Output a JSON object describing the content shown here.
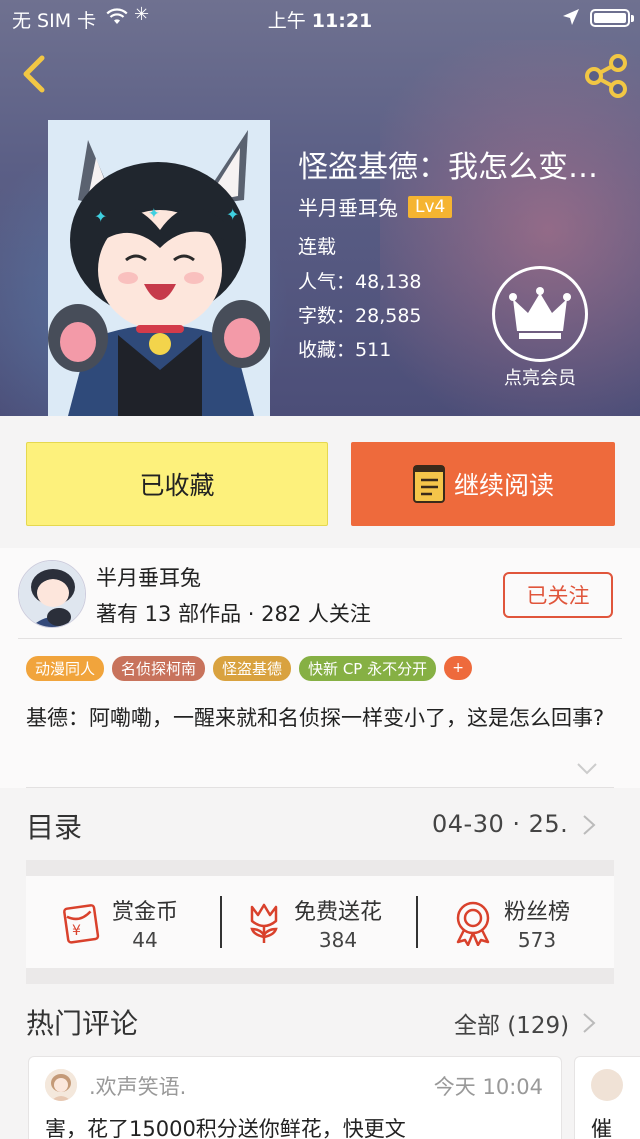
{
  "status_bar": {
    "carrier": "无 SIM 卡",
    "time_prefix": "上午",
    "time": "11:21"
  },
  "book": {
    "title": "怪盗基德：我怎么变…",
    "author": "半月垂耳兔",
    "author_level": "Lv4",
    "status": "连载",
    "popularity_label": "人气：",
    "popularity": "48,138",
    "words_label": "字数：",
    "words": "28,585",
    "favorites_label": "收藏：",
    "favorites": "511",
    "vip_label": "点亮会员"
  },
  "actions": {
    "favorited_label": "已收藏",
    "continue_label": "继续阅读"
  },
  "author_card": {
    "name": "半月垂耳兔",
    "stats": "著有 13 部作品 · 282 人关注",
    "follow_label": "已关注"
  },
  "tags": [
    {
      "label": "动漫同人",
      "color": "#f1a43c"
    },
    {
      "label": "名侦探柯南",
      "color": "#c8735c"
    },
    {
      "label": "怪盗基德",
      "color": "#d9a23f"
    },
    {
      "label": "快新 CP 永不分开",
      "color": "#86b044"
    }
  ],
  "tag_more": "+",
  "description": "基德：阿嘞嘞，一醒来就和名侦探一样变小了，这是怎么回事?",
  "toc": {
    "label": "目录",
    "latest": "04-30 · 25."
  },
  "rewards": [
    {
      "label": "赏金币",
      "value": "44",
      "icon": "red-envelope-icon"
    },
    {
      "label": "免费送花",
      "value": "384",
      "icon": "flower-icon"
    },
    {
      "label": "粉丝榜",
      "value": "573",
      "icon": "medal-icon"
    }
  ],
  "comments_section": {
    "label": "热门评论",
    "all_label": "全部 (129)"
  },
  "comments": [
    {
      "user": ".欢声笑语.",
      "time": "今天 10:04",
      "text": "害，花了15000积分送你鲜花，快更文"
    },
    {
      "text": "催"
    }
  ],
  "colors": {
    "accent_orange": "#ee6a3c",
    "favorite_yellow": "#fdf17c",
    "level_badge": "#f5b431",
    "follow_red": "#e0553b",
    "reward_red": "#d9412c"
  }
}
